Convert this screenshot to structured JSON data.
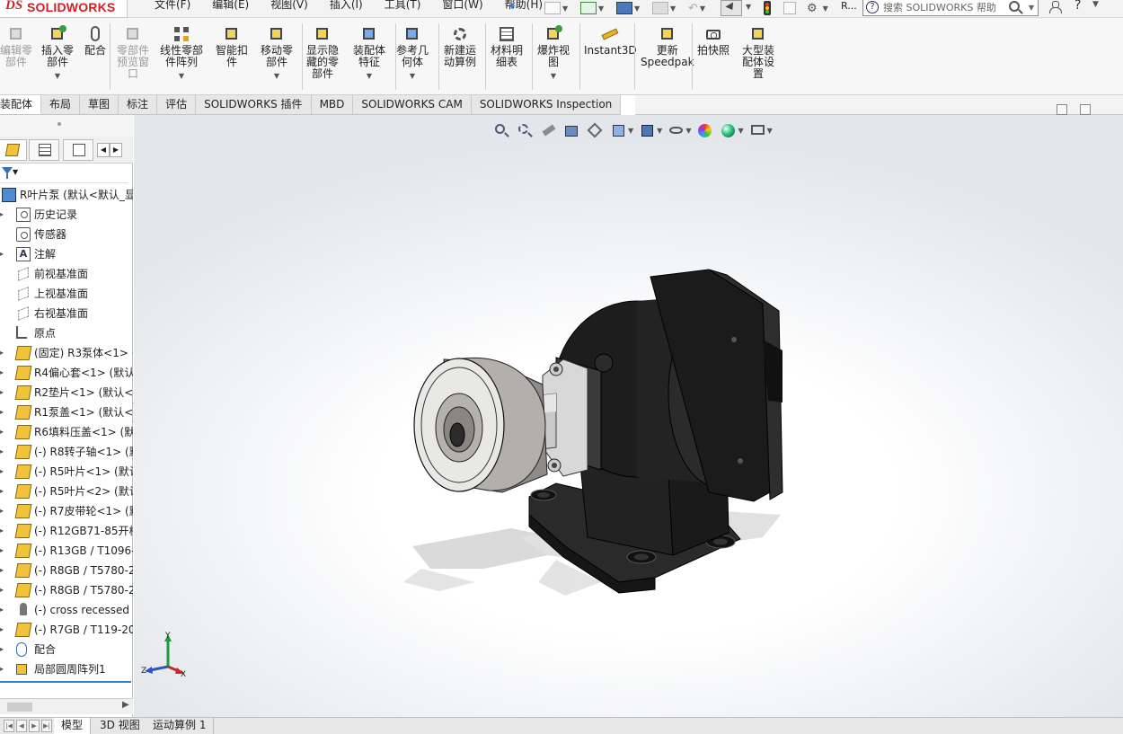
{
  "app": {
    "logo_ds": "DS",
    "logo_brand": "SOLIDWORKS"
  },
  "menu": [
    "文件(F)",
    "编辑(E)",
    "视图(V)",
    "插入(I)",
    "工具(T)",
    "窗口(W)",
    "帮助(H)"
  ],
  "titlebar": {
    "r_label": "R...",
    "search_placeholder": "搜索 SOLIDWORKS 帮助",
    "help_label": "?"
  },
  "ribbon": {
    "tools": [
      {
        "id": "edit-component",
        "label": "编辑零\n部件",
        "disabled": true,
        "icon": "edit-component-icon"
      },
      {
        "id": "insert-component",
        "label": "插入零\n部件",
        "disabled": false,
        "icon": "insert-component-icon",
        "dropdown": true
      },
      {
        "id": "mate",
        "label": "配合",
        "disabled": false,
        "icon": "mate-icon"
      },
      {
        "id": "component-preview",
        "label": "零部件\n预览窗\n口",
        "disabled": true,
        "icon": "component-preview-icon"
      },
      {
        "id": "linear-pattern",
        "label": "线性零部\n件阵列",
        "disabled": false,
        "icon": "linear-pattern-icon",
        "dropdown": true
      },
      {
        "id": "smart-fasteners",
        "label": "智能扣\n件",
        "disabled": false,
        "icon": "smart-fasteners-icon"
      },
      {
        "id": "move-component",
        "label": "移动零\n部件",
        "disabled": false,
        "icon": "move-component-icon",
        "dropdown": true
      },
      {
        "id": "show-hidden",
        "label": "显示隐\n藏的零\n部件",
        "disabled": false,
        "icon": "show-hidden-icon"
      },
      {
        "id": "assembly-features",
        "label": "装配体\n特征",
        "disabled": false,
        "icon": "assembly-features-icon",
        "dropdown": true
      },
      {
        "id": "reference-geometry",
        "label": "参考几\n何体",
        "disabled": false,
        "icon": "reference-geometry-icon",
        "dropdown": true
      },
      {
        "id": "new-motion-study",
        "label": "新建运\n动算例",
        "disabled": false,
        "icon": "new-motion-study-icon"
      },
      {
        "id": "bom",
        "label": "材料明\n细表",
        "disabled": false,
        "icon": "bom-icon"
      },
      {
        "id": "exploded-view",
        "label": "爆炸视\n图",
        "disabled": false,
        "icon": "exploded-view-icon",
        "dropdown": true
      },
      {
        "id": "instant3d",
        "label": "Instant3D",
        "disabled": false,
        "icon": "instant3d-icon"
      },
      {
        "id": "update-speedpak",
        "label": "更新\nSpeedpak",
        "disabled": false,
        "icon": "update-speedpak-icon"
      },
      {
        "id": "snapshot",
        "label": "拍快照",
        "disabled": false,
        "icon": "snapshot-icon"
      },
      {
        "id": "large-assembly",
        "label": "大型装\n配体设\n置",
        "disabled": false,
        "icon": "large-assembly-icon"
      }
    ]
  },
  "command_tabs": [
    "装配体",
    "布局",
    "草图",
    "标注",
    "评估",
    "SOLIDWORKS 插件",
    "MBD",
    "SOLIDWORKS CAM",
    "SOLIDWORKS Inspection"
  ],
  "feature_tree": {
    "nodes": [
      {
        "label": "R叶片泵  (默认<默认_显",
        "icon": "assembly-root-icon",
        "kind": "root",
        "expand": false
      },
      {
        "label": "历史记录",
        "icon": "history-icon",
        "kind": "hist",
        "expand": true
      },
      {
        "label": "传感器",
        "icon": "sensor-icon",
        "kind": "sensor",
        "expand": false
      },
      {
        "label": "注解",
        "icon": "annotation-icon",
        "kind": "anno",
        "expand": true
      },
      {
        "label": "前视基准面",
        "icon": "plane-icon",
        "kind": "plane",
        "expand": false
      },
      {
        "label": "上视基准面",
        "icon": "plane-icon",
        "kind": "plane",
        "expand": false
      },
      {
        "label": "右视基准面",
        "icon": "plane-icon",
        "kind": "plane",
        "expand": false
      },
      {
        "label": "原点",
        "icon": "origin-icon",
        "kind": "origin",
        "expand": false
      },
      {
        "label": "(固定) R3泵体<1> (",
        "icon": "part-icon",
        "kind": "asm",
        "expand": true
      },
      {
        "label": "R4偏心套<1> (默认",
        "icon": "part-icon",
        "kind": "asm",
        "expand": true
      },
      {
        "label": "R2垫片<1> (默认<",
        "icon": "part-icon",
        "kind": "asm",
        "expand": true
      },
      {
        "label": "R1泵盖<1> (默认<",
        "icon": "part-icon",
        "kind": "asm",
        "expand": true
      },
      {
        "label": "R6填料压盖<1> (默",
        "icon": "part-icon",
        "kind": "asm",
        "expand": true
      },
      {
        "label": "(-) R8转子轴<1> (默",
        "icon": "part-icon",
        "kind": "asm",
        "expand": true
      },
      {
        "label": "(-) R5叶片<1> (默认",
        "icon": "part-icon",
        "kind": "asm",
        "expand": true
      },
      {
        "label": "(-) R5叶片<2> (默认",
        "icon": "part-icon",
        "kind": "asm",
        "expand": true
      },
      {
        "label": "(-) R7皮带轮<1> (默",
        "icon": "part-icon",
        "kind": "asm",
        "expand": true
      },
      {
        "label": "(-) R12GB71-85开槽",
        "icon": "part-icon",
        "kind": "asm",
        "expand": true
      },
      {
        "label": "(-) R13GB / T1096-",
        "icon": "part-icon",
        "kind": "asm",
        "expand": true
      },
      {
        "label": "(-) R8GB / T5780-2",
        "icon": "part-icon",
        "kind": "asm",
        "expand": true
      },
      {
        "label": "(-) R8GB / T5780-2",
        "icon": "part-icon",
        "kind": "asm",
        "expand": true
      },
      {
        "label": "(-) cross recessed",
        "icon": "screw-icon",
        "kind": "screw",
        "expand": true
      },
      {
        "label": "(-) R7GB / T119-20",
        "icon": "part-icon",
        "kind": "asm",
        "expand": true
      },
      {
        "label": "配合",
        "icon": "mates-icon",
        "kind": "mate",
        "expand": true
      },
      {
        "label": "局部圆周阵列1",
        "icon": "circular-pattern-icon",
        "kind": "pattern",
        "expand": true
      }
    ]
  },
  "triad": {
    "x": "X",
    "y": "Y",
    "z": "Z"
  },
  "bottom_tabs": [
    "模型",
    "3D 视图",
    "运动算例 1"
  ]
}
